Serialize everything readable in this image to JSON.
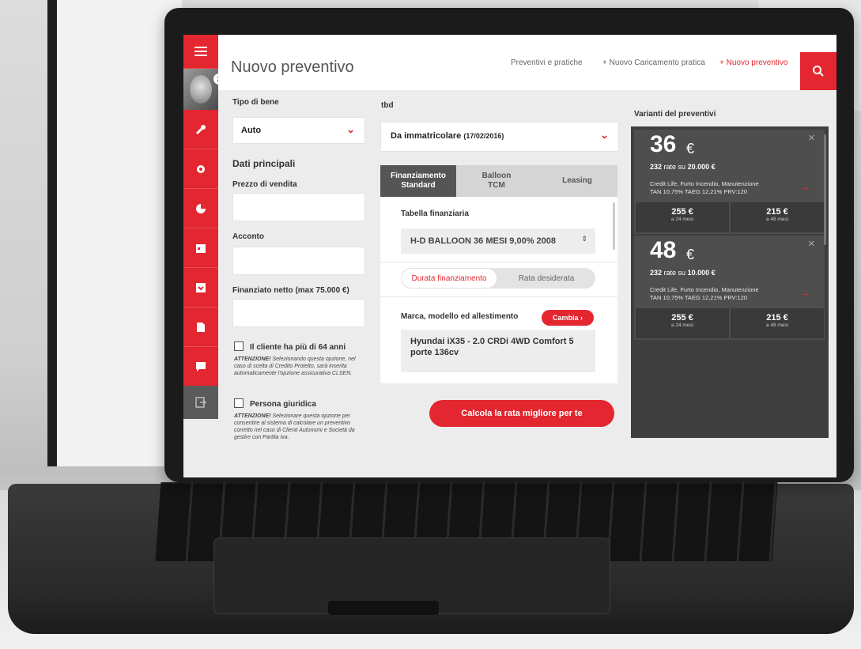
{
  "header": {
    "title": "Nuovo preventivo",
    "nav": [
      "Preventivi e pratiche",
      "+ Nuovo Caricamento pratica",
      "+ Nuovo preventivo"
    ]
  },
  "sidebar": {
    "badge": "2",
    "icons": [
      "menu-icon",
      "wrench-icon",
      "gear-icon",
      "pie-chart-icon",
      "calendar-icon",
      "archive-icon",
      "document-icon",
      "chat-icon",
      "exit-icon"
    ]
  },
  "left": {
    "tipo_label": "Tipo di bene",
    "tipo_value": "Auto",
    "section_title": "Dati principali",
    "prezzo_label": "Prezzo di vendita",
    "acconto_label": "Acconto",
    "finanziato_label": "Finanziato netto (max 75.000 €)",
    "cliente_label": "Il cliente ha più di 64 anni",
    "cliente_note_strong": "ATTENZIONE!",
    "cliente_note": " Selezionando questa opzione, nel caso di scelta di Credito Protetto, sarà inserita automaticamente l'opzione assicurativa CLSEN.",
    "persona_label": "Persona giuridica",
    "persona_note_strong": "ATTENZIONE!",
    "persona_note": " Selezionare questa opzione per consentire al sistema di calcolare un preventivo corretto nel caso di Clienti Autonomi e Società da gestire con Partita Iva."
  },
  "middle": {
    "tbd_label": "tbd",
    "immatricolare_value": "Da immatricolare",
    "immatricolare_date": "(17/02/2016)",
    "tabs": [
      {
        "line1": "Finanziamento",
        "line2": "Standard"
      },
      {
        "line1": "Balloon",
        "line2": "TCM"
      },
      {
        "line1": "Leasing",
        "line2": ""
      }
    ],
    "tabella_label": "Tabella finanziaria",
    "tabella_value": "H-D BALLOON 36 MESI 9,00% 2008",
    "toggle_left": "Durata finanziamento",
    "toggle_right": "Rata desiderata",
    "marca_label": "Marca, modello ed allestimento",
    "cambia_label": "Cambia",
    "model_value": "Hyundai iX35 - 2.0 CRDi 4WD Comfort 5 porte 136cv",
    "cta_label": "Calcola la rata migliore per te"
  },
  "variants": {
    "title": "Varianti del preventivi",
    "cards": [
      {
        "months": "36",
        "currency": "€",
        "rate_prefix": "232",
        "rate_mid": "rate su",
        "amount": "20.000 €",
        "services": "Credit Life, Furto Incendio, Manutenzione",
        "terms": "TAN 10,75% TAEG 12,21% PRV:120",
        "alt1_value": "255 €",
        "alt1_months": "a 24 mesi",
        "alt2_value": "215 €",
        "alt2_months": "a 48 mesi"
      },
      {
        "months": "48",
        "currency": "€",
        "rate_prefix": "232",
        "rate_mid": "rate su",
        "amount": "10.000 €",
        "services": "Credit Life, Furto Incendio, Manutenzione",
        "terms": "TAN 10,75% TAEG 12,21% PRV:120",
        "alt1_value": "255 €",
        "alt1_months": "a 24 mesi",
        "alt2_value": "215 €",
        "alt2_months": "a 48 mesi"
      }
    ]
  },
  "device": {
    "label": "MacBook Pro"
  },
  "colors": {
    "accent": "#e3262f",
    "dark_panel": "#3e3e3e",
    "screen_bg": "#ececec"
  }
}
